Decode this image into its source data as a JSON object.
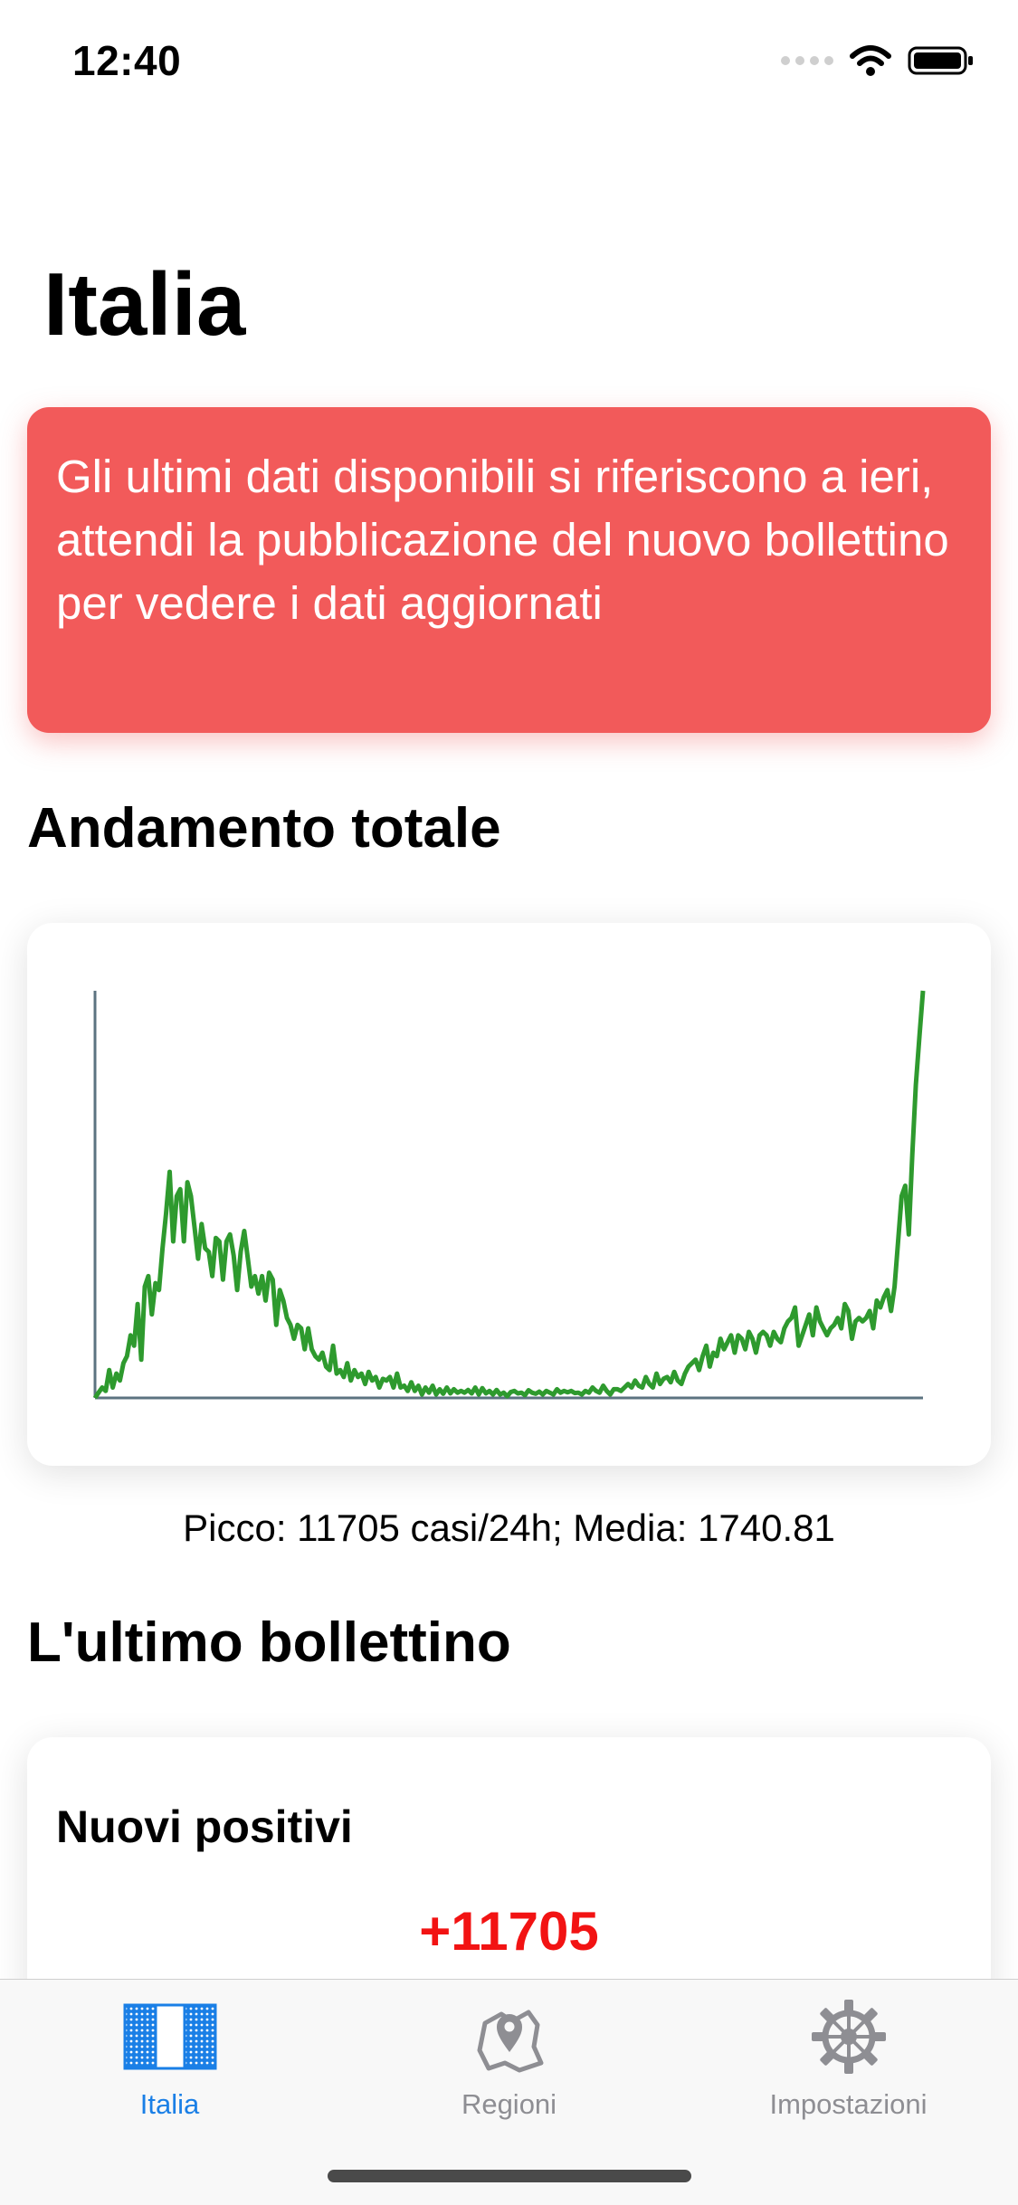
{
  "status": {
    "time": "12:40"
  },
  "page": {
    "title": "Italia"
  },
  "alert": {
    "message": "Gli ultimi dati disponibili si riferiscono a ieri, attendi la pubblicazione del nuovo bollettino per vedere i dati aggiornati"
  },
  "sections": {
    "trend_title": "Andamento totale",
    "bulletin_title": "L'ultimo bollettino"
  },
  "chart_caption": "Picco: 11705 casi/24h; Media: 1740.81",
  "chart_data": {
    "type": "line",
    "title": "",
    "xlabel": "",
    "ylabel": "",
    "ylim": [
      0,
      11705
    ],
    "series_color": "#2e9a2e",
    "series": [
      {
        "values": [
          0,
          150,
          300,
          200,
          800,
          300,
          700,
          500,
          1000,
          1200,
          1800,
          1500,
          2700,
          1100,
          3200,
          3500,
          2400,
          3300,
          3100,
          4300,
          5300,
          6500,
          4500,
          5800,
          6000,
          4500,
          6200,
          5800,
          4900,
          4000,
          5000,
          4300,
          4200,
          3500,
          4600,
          4500,
          3400,
          4500,
          4700,
          4100,
          3100,
          4200,
          4800,
          4000,
          3200,
          3500,
          3000,
          3500,
          2800,
          3600,
          3400,
          2100,
          3100,
          2800,
          2300,
          2100,
          1700,
          2100,
          2000,
          1400,
          2000,
          1400,
          1200,
          1100,
          1300,
          900,
          800,
          1500,
          700,
          800,
          600,
          1000,
          500,
          800,
          600,
          700,
          400,
          750,
          500,
          600,
          300,
          550,
          500,
          600,
          300,
          700,
          300,
          350,
          200,
          450,
          200,
          350,
          100,
          300,
          150,
          350,
          100,
          250,
          120,
          300,
          130,
          250,
          150,
          200,
          150,
          230,
          130,
          300,
          100,
          280,
          130,
          200,
          100,
          230,
          100,
          150,
          50,
          170,
          200,
          130,
          150,
          80,
          220,
          150,
          120,
          180,
          100,
          200,
          150,
          100,
          250,
          150,
          200,
          160,
          200,
          140,
          150,
          100,
          200,
          150,
          300,
          200,
          150,
          350,
          200,
          100,
          250,
          250,
          200,
          300,
          400,
          300,
          500,
          350,
          300,
          600,
          400,
          300,
          700,
          400,
          550,
          600,
          450,
          750,
          500,
          400,
          700,
          900,
          1000,
          1100,
          800,
          1200,
          1500,
          900,
          1300,
          1200,
          1700,
          1400,
          1600,
          1800,
          1300,
          1800,
          1700,
          1400,
          1900,
          1700,
          1300,
          1800,
          1900,
          1800,
          1500,
          1900,
          1700,
          1600,
          2000,
          2200,
          2300,
          2600,
          1500,
          1800,
          2100,
          2400,
          1800,
          2600,
          2200,
          2000,
          1800,
          2000,
          2100,
          2300,
          2000,
          2700,
          2500,
          1700,
          2200,
          2300,
          2200,
          2300,
          2500,
          2000,
          2800,
          2600,
          2900,
          3100,
          2500,
          3200,
          4500,
          5800,
          6100,
          4700,
          7000,
          9000,
          10400,
          11705
        ]
      }
    ]
  },
  "bulletin": {
    "label": "Nuovi positivi",
    "value": "+11705"
  },
  "tabs": [
    {
      "label": "Italia",
      "icon": "italy-flag-icon",
      "active": true
    },
    {
      "label": "Regioni",
      "icon": "map-pin-icon",
      "active": false
    },
    {
      "label": "Impostazioni",
      "icon": "gear-icon",
      "active": false
    }
  ],
  "colors": {
    "accent": "#1a7fe6",
    "alert": "#f25a5a",
    "positive_value": "#f21313",
    "inactive_tab": "#8e8e93"
  }
}
